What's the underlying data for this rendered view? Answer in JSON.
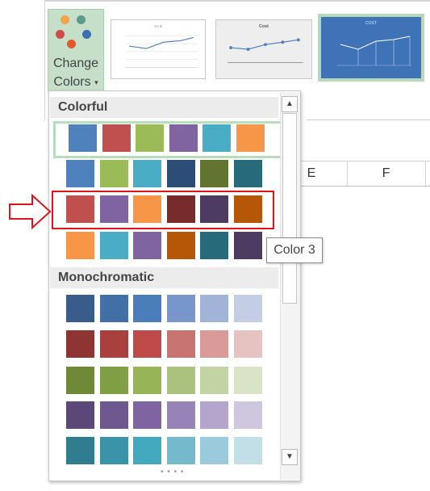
{
  "ribbon": {
    "change_colors": {
      "line1": "Change",
      "line2": "Colors",
      "caret": "▾"
    },
    "style_thumbnails": [
      {
        "title": "Cr d"
      },
      {
        "title": "Cost"
      },
      {
        "title": "COST"
      }
    ]
  },
  "sheet": {
    "columns": [
      "E",
      "F"
    ]
  },
  "gallery": {
    "sections": [
      {
        "title": "Colorful",
        "rows": [
          [
            "#4f81bd",
            "#c0504d",
            "#9bbb59",
            "#8064a2",
            "#4bacc6",
            "#f79646"
          ],
          [
            "#4f81bd",
            "#9bbb59",
            "#4bacc6",
            "#2c4d75",
            "#5f7530",
            "#276a7c"
          ],
          [
            "#c0504d",
            "#8064a2",
            "#f79646",
            "#772c2a",
            "#4d3b62",
            "#b65708"
          ],
          [
            "#f79646",
            "#4bacc6",
            "#8064a2",
            "#b65708",
            "#276a7c",
            "#4d3b62"
          ]
        ]
      },
      {
        "title": "Monochromatic",
        "rows": [
          [
            "#385d8a",
            "#416fa6",
            "#4a7ebb",
            "#7896c9",
            "#a1b4d7",
            "#c3cde4"
          ],
          [
            "#8e3533",
            "#a9403d",
            "#be4b48",
            "#c87473",
            "#d99b9a",
            "#e6c2c1"
          ],
          [
            "#6e8a39",
            "#809f44",
            "#97b557",
            "#aac27e",
            "#c3d4a4",
            "#d9e4c6"
          ],
          [
            "#5c4878",
            "#6e588f",
            "#8064a2",
            "#9883b6",
            "#b3a5cc",
            "#d0c7df"
          ],
          [
            "#317d90",
            "#3a93a8",
            "#43a9bf",
            "#75bacc",
            "#9bcadc",
            "#c2dfe8"
          ]
        ]
      }
    ],
    "selected_row": "0.0",
    "highlighted_row": "0.2",
    "scroll_up": "▲",
    "scroll_down": "▼",
    "resize_grip": "• • • •"
  },
  "annotation": {
    "arrow_color": "#e0141d",
    "box_color": "#e0141d"
  },
  "tooltip": {
    "text": "Color 3"
  }
}
